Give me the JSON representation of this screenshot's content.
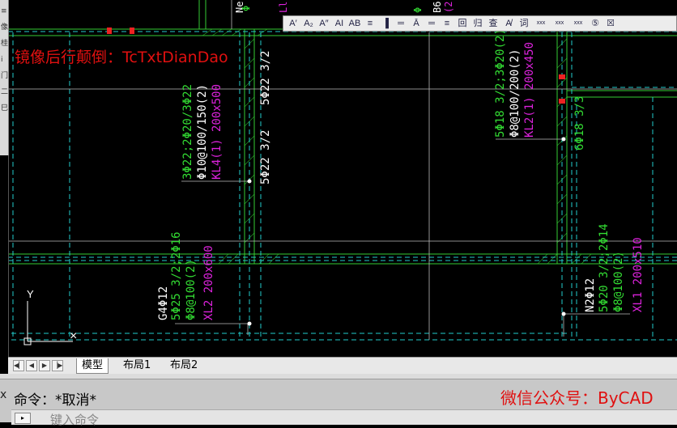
{
  "overlay": {
    "command_note": "镜像后行颠倒：TcTxtDianDao"
  },
  "left_palette": {
    "items": [
      "≡",
      "像",
      "桂",
      "i",
      "门",
      "二",
      "巳"
    ]
  },
  "text_toolbar": {
    "buttons": [
      {
        "label": "A′",
        "icon": "superscript-icon"
      },
      {
        "label": "A₂",
        "icon": "subscript-icon"
      },
      {
        "label": "A″",
        "icon": "char-style-icon"
      },
      {
        "label": "AI",
        "icon": "italic-icon"
      },
      {
        "label": "AB",
        "icon": "strike-icon"
      },
      {
        "label": "≡",
        "icon": "align-icon"
      },
      {
        "label": "▐",
        "icon": "column-icon"
      },
      {
        "label": "═",
        "icon": "underline-icon"
      },
      {
        "label": "Ā",
        "icon": "overline-icon"
      },
      {
        "label": "═",
        "icon": "double-line-icon"
      },
      {
        "label": "≡",
        "icon": "paragraph-icon"
      },
      {
        "label": "回",
        "icon": "frame-icon"
      },
      {
        "label": "归",
        "icon": "merge-icon"
      },
      {
        "label": "查",
        "icon": "find-icon"
      },
      {
        "label": "A̸",
        "icon": "spell-check-icon"
      },
      {
        "label": "词",
        "icon": "word-library-icon"
      },
      {
        "label": "xxx",
        "icon": "special-char-icon"
      },
      {
        "label": "xxx",
        "icon": "special-char-icon-2"
      },
      {
        "label": "xxx",
        "icon": "special-char-icon-3"
      },
      {
        "label": "⑤",
        "icon": "circled-number-icon"
      },
      {
        "label": "☒",
        "icon": "close-toolbar-icon"
      }
    ]
  },
  "drawing": {
    "annotations": [
      {
        "text": "3Φ22;2Φ20/3Φ22",
        "color": "#33dd33"
      },
      {
        "text": "Φ10@100/150(2)",
        "color": "#ffffff"
      },
      {
        "text": "KL4(1) 200x500",
        "color": "#dd22dd"
      },
      {
        "text": "5Φ22 3/2",
        "color": "#ffffff"
      },
      {
        "text": "5Φ22 3/2",
        "color": "#ffffff"
      },
      {
        "text": "5Φ18 3/2;3Φ20(2)",
        "color": "#33dd33"
      },
      {
        "text": "Φ8@100/200(2)",
        "color": "#ffffff"
      },
      {
        "text": "KL2(1) 200x450",
        "color": "#dd22dd"
      },
      {
        "text": "6Φ18 3/3",
        "color": "#33dd33"
      },
      {
        "text": "G4Φ12",
        "color": "#ffffff"
      },
      {
        "text": "5Φ25 3/2;2Φ16",
        "color": "#33dd33"
      },
      {
        "text": "Φ8@100(2)",
        "color": "#33dd33"
      },
      {
        "text": "XL2 200x600",
        "color": "#dd22dd"
      },
      {
        "text": "N2Φ12",
        "color": "#ffffff"
      },
      {
        "text": "5Φ20 3/2;2Φ14",
        "color": "#33dd33"
      },
      {
        "text": "Φ8@100(2)",
        "color": "#33dd33"
      },
      {
        "text": "XL1 200x510",
        "color": "#dd22dd"
      }
    ],
    "top_labels": [
      {
        "text": "Ne",
        "color": "#ffffff"
      },
      {
        "text": "Φ",
        "color": "#33dd33"
      },
      {
        "text": "Ll",
        "color": "#dd22dd"
      },
      {
        "text": "Φ",
        "color": "#33dd33"
      },
      {
        "text": "B6",
        "color": "#ffffff"
      },
      {
        "text": "(2)",
        "color": "#dd22dd"
      }
    ],
    "ucs": {
      "y_label": "Y",
      "x_marker": "×"
    }
  },
  "layout_tabs": {
    "nav_buttons": [
      "◀▏",
      "◀",
      "▶",
      "▕▶"
    ],
    "tabs": [
      {
        "label": "模型",
        "active": true
      },
      {
        "label": "布局1",
        "active": false
      },
      {
        "label": "布局2",
        "active": false
      }
    ]
  },
  "command_line": {
    "close_glyph": "x",
    "history": "命令：*取消*",
    "input_button": "▸",
    "placeholder": "键入命令"
  },
  "watermark": "微信公众号：ByCAD"
}
